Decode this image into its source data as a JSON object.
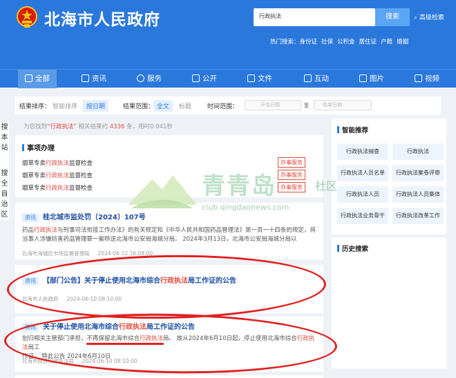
{
  "header": {
    "site_title": "北海市人民政府",
    "search_value": "行政执法",
    "search_button": "搜索",
    "advanced_search": "高级检索",
    "hot_label": "热门搜索：",
    "hot_terms": [
      "身份证",
      "社保",
      "公积金",
      "居住证",
      "户籍",
      "婚姻"
    ]
  },
  "nav": [
    {
      "label": "全部",
      "active": true
    },
    {
      "label": "资讯"
    },
    {
      "label": "服务"
    },
    {
      "label": "公开"
    },
    {
      "label": "文件"
    },
    {
      "label": "互动"
    },
    {
      "label": "图片"
    },
    {
      "label": "视频"
    }
  ],
  "filter": {
    "sort_label": "结果排序：",
    "sort_options": [
      "智能排序",
      "按日期"
    ],
    "range_label": "结果范围：",
    "range_options": [
      "全文",
      "标题"
    ],
    "time_label": "时间范围：",
    "start_placeholder": "开始日期",
    "sep": "至",
    "end_placeholder": "结束日期"
  },
  "leftbar": {
    "lines": [
      "搜",
      "本",
      "站",
      "",
      "搜",
      "全",
      "自",
      "治",
      "区"
    ]
  },
  "count": {
    "prefix": "为您找到",
    "keyword": "“行政执法”",
    "middle": "相关结果约",
    "number": "4336",
    "suffix": "条，用时0.041秒"
  },
  "service_card": {
    "title": "事项办理",
    "items": [
      {
        "pre": "烟草专卖",
        "kw": "行政执法",
        "post": "监督检查",
        "button": "办事服务"
      },
      {
        "pre": "烟草专卖",
        "kw": "行政执法",
        "post": "监督检查",
        "button": "办事服务"
      },
      {
        "pre": "烟草专卖",
        "kw": "行政执法",
        "post": "监督检查",
        "button": "办事服务"
      }
    ]
  },
  "results": [
    {
      "tag": "资讯",
      "title": "桂北城市监处罚〔2024〕107号",
      "body_1": "药品",
      "body_kw": "行政执法",
      "body_2": "与刑事司法衔接工作办法》的有关规定和《中华人民共和国药品管理法》第一百一十四条的规定，将",
      "body_3": "当事人涉嫌妨害药品管理罪一案移送北海市公安局海城分局。 2024年3月13日，北海市公安局海城分局以",
      "source": "北海市海城区市场监督管理局",
      "date": "2024-06-12 16:08:00"
    },
    {
      "tag": "资讯",
      "title_1": "【部门公告】关于停止使用北海市综合",
      "title_kw": "行政执法",
      "title_2": "局工作证的公告",
      "source": "北海市人民政府",
      "date": "2024-06-10 08:10:00"
    },
    {
      "tag": "资讯",
      "title_1": "关于停止使用北海市综合",
      "title_kw": "行政执法",
      "title_2": "局工作证的公告",
      "body_1": "划归相关主管部门承担，不再保留北海市综合",
      "body_kw1": "行政执法",
      "body_2": "局。 故从2024年6月10日起，停止使用北海市综合",
      "body_kw2": "行政执法",
      "body_3": "局工",
      "body_4": "作证。 特此公告 2024年6月10日",
      "source": "北海市综合行政执法局",
      "date": "2024-06-10 08:10:00"
    }
  ],
  "sidebar": {
    "recommend_title": "智能推荐",
    "recommend": [
      "行政执法抽查",
      "行政执法",
      "行政执法人员名单",
      "行政执法案卷评审",
      "行政执法人员",
      "行政执法人员集体",
      "行政执法业务骨干",
      "行政执法改革工作"
    ],
    "history_title": "历史搜索"
  },
  "watermark": {
    "text": "青青岛",
    "tag": "社区",
    "url": "club.qingdaonews.com"
  },
  "colors": {
    "header_blue": "#2b78dd",
    "keyword_red": "#e34a3c",
    "annotation_red": "#e02020"
  }
}
